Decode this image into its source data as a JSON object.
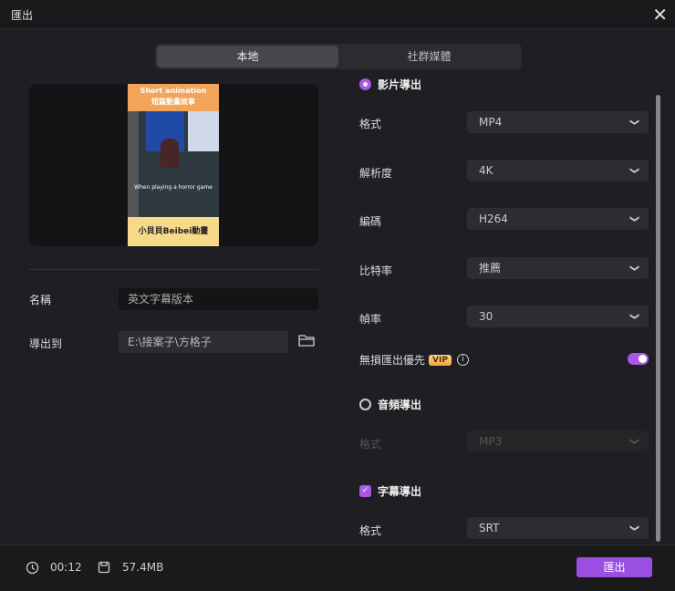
{
  "window": {
    "title": "匯出",
    "close": "✕"
  },
  "tabs": [
    {
      "label": "本地"
    },
    {
      "label": "社群媒體"
    }
  ],
  "preview": {
    "thumb_top1": "Short animation",
    "thumb_top2": "短篇動畫故事",
    "thumb_sub": "When playing a horror game",
    "thumb_bottom": "小貝貝Beibei動畫"
  },
  "name": {
    "label": "名稱",
    "value": "英文字幕版本"
  },
  "export_to": {
    "label": "導出到",
    "value": "E:\\接案子\\方格子"
  },
  "video": {
    "section": "影片導出",
    "format_label": "格式",
    "format": "MP4",
    "resolution_label": "解析度",
    "resolution": "4K",
    "codec_label": "編碼",
    "codec": "H264",
    "bitrate_label": "比特率",
    "bitrate": "推薦",
    "fps_label": "幀率",
    "fps": "30",
    "lossless_label": "無損匯出優先",
    "vip": "VIP",
    "info": "i"
  },
  "audio": {
    "section": "音頻導出",
    "format_label": "格式",
    "format": "MP3"
  },
  "subtitle": {
    "section": "字幕導出",
    "check": "✓",
    "format_label": "格式",
    "format": "SRT"
  },
  "footer": {
    "duration": "00:12",
    "size": "57.4MB",
    "export_button": "匯出"
  },
  "colors": {
    "accent": "#a958e8",
    "button": "#9b4fe0"
  }
}
